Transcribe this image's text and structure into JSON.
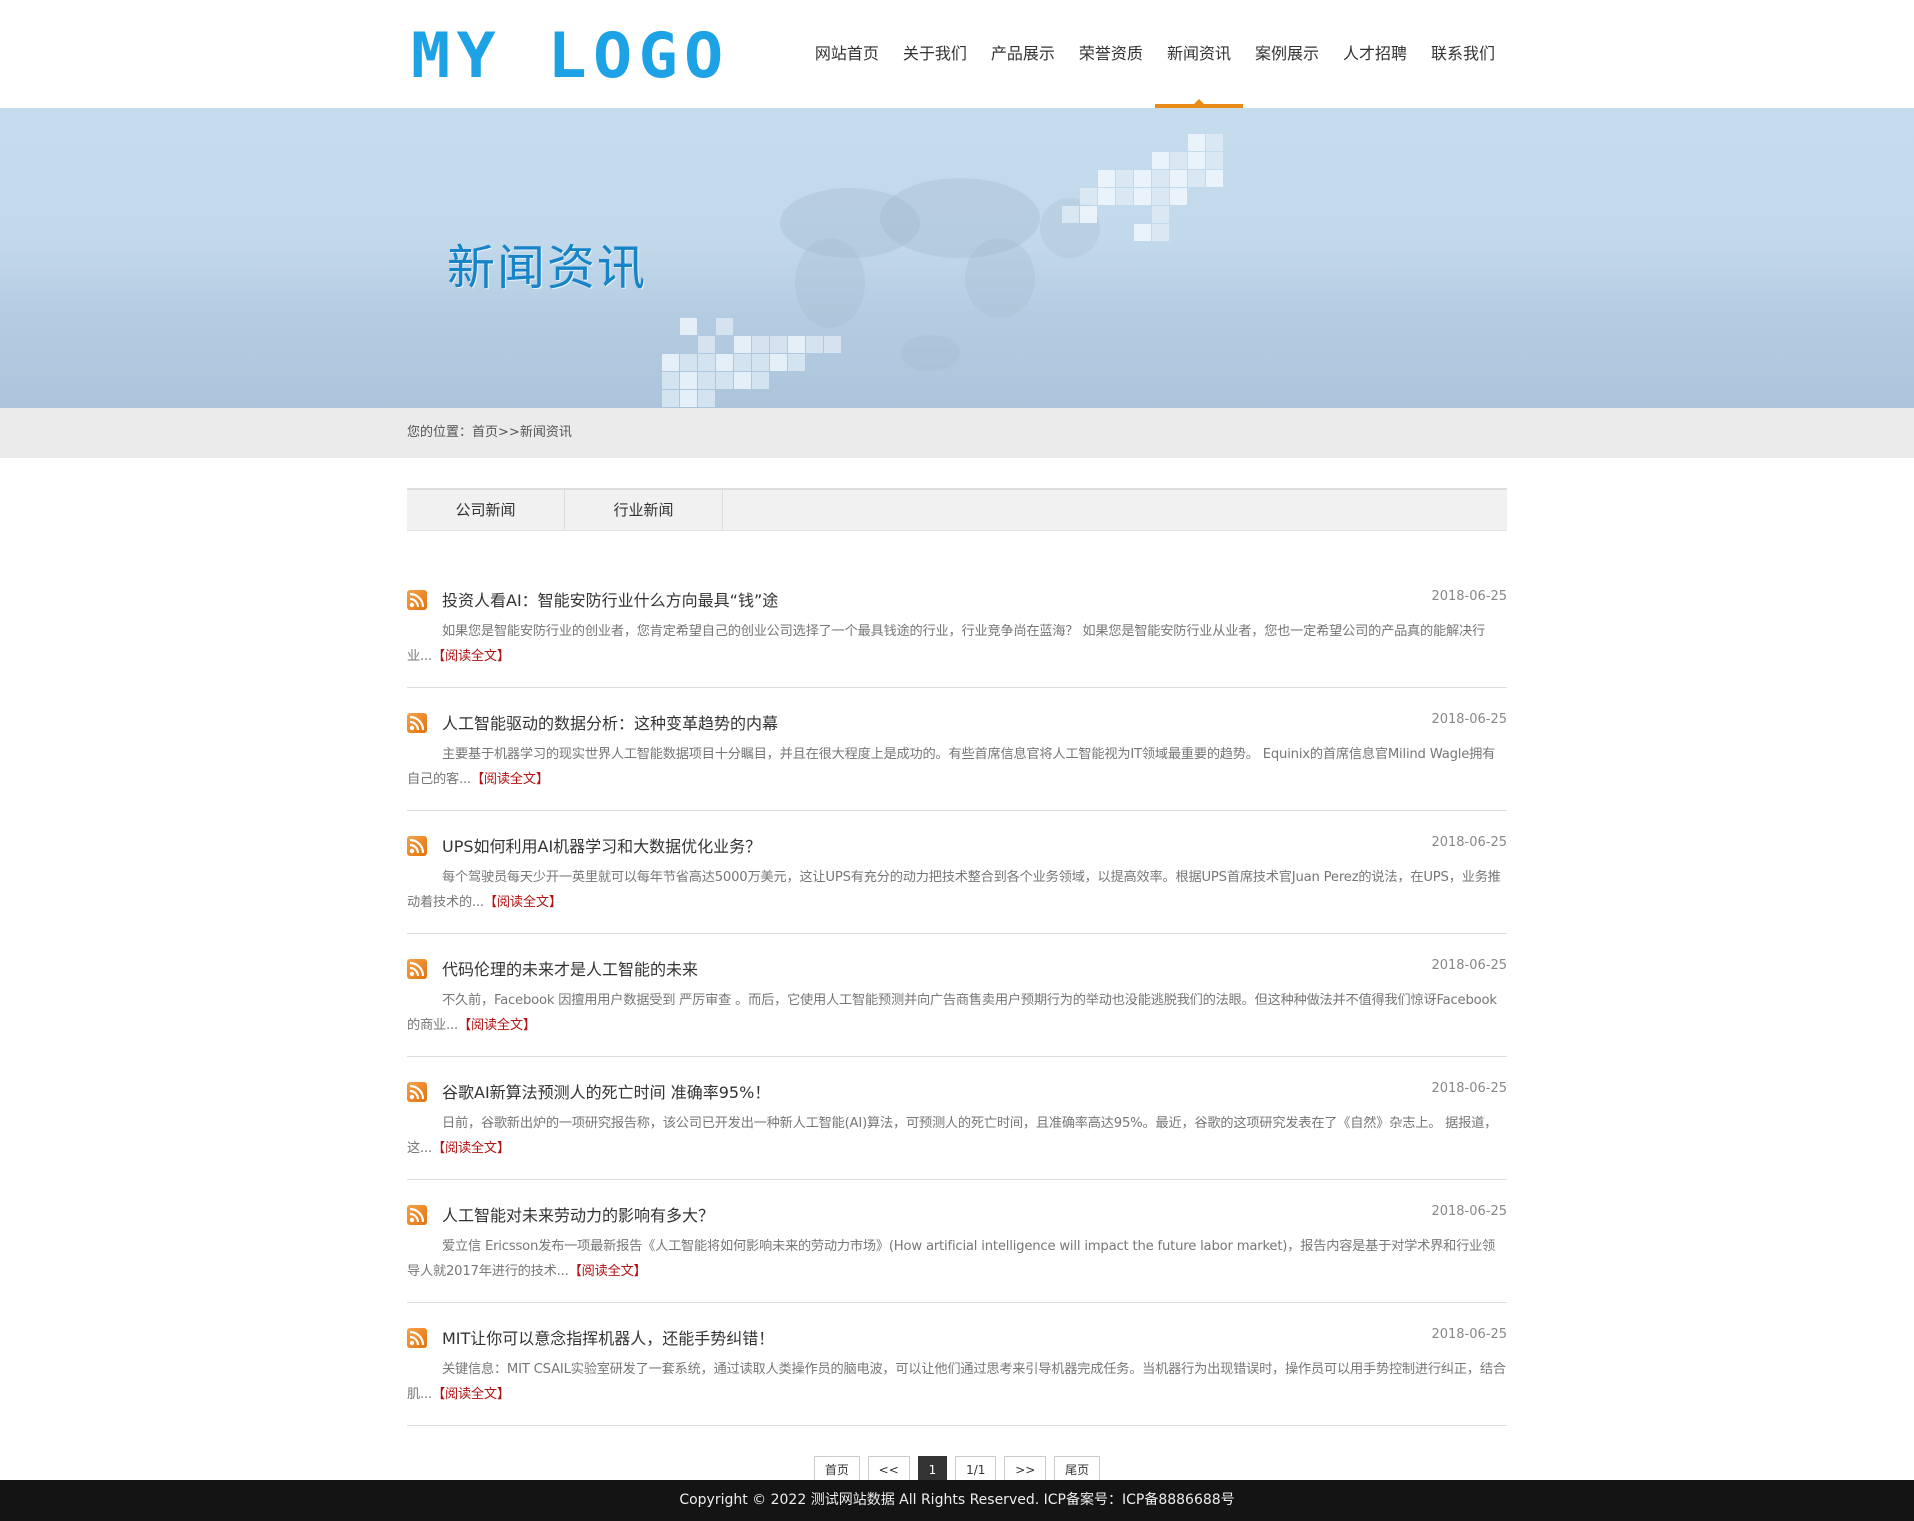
{
  "logo": {
    "text": "MY LOGO"
  },
  "nav": {
    "items": [
      "网站首页",
      "关于我们",
      "产品展示",
      "荣誉资质",
      "新闻资讯",
      "案例展示",
      "人才招聘",
      "联系我们"
    ],
    "active": "新闻资讯"
  },
  "banner": {
    "title": "新闻资讯"
  },
  "breadcrumb": {
    "prefix": "您的位置：",
    "home": "首页",
    "separator": ">>",
    "current": "新闻资讯"
  },
  "tabs": [
    "公司新闻",
    "行业新闻"
  ],
  "news": [
    {
      "title": "投资人看AI：智能安防行业什么方向最具“钱”途",
      "date": "2018-06-25",
      "summary": "如果您是智能安防行业的创业者，您肯定希望自己的创业公司选择了一个最具钱途的行业，行业竞争尚在蓝海？ 如果您是智能安防行业从业者，您也一定希望公司的产品真的能解决行业...",
      "more": "【阅读全文】"
    },
    {
      "title": "人工智能驱动的数据分析：这种变革趋势的内幕",
      "date": "2018-06-25",
      "summary": "主要基于机器学习的现实世界人工智能数据项目十分瞩目，并且在很大程度上是成功的。有些首席信息官将人工智能视为IT领域最重要的趋势。 Equinix的首席信息官Milind Wagle拥有自己的客...",
      "more": "【阅读全文】"
    },
    {
      "title": "UPS如何利用AI机器学习和大数据优化业务？",
      "date": "2018-06-25",
      "summary": "每个驾驶员每天少开一英里就可以每年节省高达5000万美元，这让UPS有充分的动力把技术整合到各个业务领域，以提高效率。根据UPS首席技术官Juan Perez的说法，在UPS，业务推动着技术的...",
      "more": "【阅读全文】"
    },
    {
      "title": "代码伦理的未来才是人工智能的未来",
      "date": "2018-06-25",
      "summary": "不久前，Facebook 因擅用用户数据受到 严厉审查 。而后，它使用人工智能预测并向广告商售卖用户预期行为的举动也没能逃脱我们的法眼。但这种种做法并不值得我们惊讶Facebook 的商业...",
      "more": "【阅读全文】"
    },
    {
      "title": "谷歌AI新算法预测人的死亡时间 准确率95%！",
      "date": "2018-06-25",
      "summary": "日前，谷歌新出炉的一项研究报告称，该公司已开发出一种新人工智能(AI)算法，可预测人的死亡时间，且准确率高达95%。最近，谷歌的这项研究发表在了《自然》杂志上。 据报道，这...",
      "more": "【阅读全文】"
    },
    {
      "title": "人工智能对未来劳动力的影响有多大？",
      "date": "2018-06-25",
      "summary": "爱立信 Ericsson发布一项最新报告《人工智能将如何影响未来的劳动力市场》(How artificial intelligence will impact the future labor market)，报告内容是基于对学术界和行业领导人就2017年进行的技术...",
      "more": "【阅读全文】"
    },
    {
      "title": "MIT让你可以意念指挥机器人，还能手势纠错！",
      "date": "2018-06-25",
      "summary": "关键信息：MIT CSAIL实验室研发了一套系统，通过读取人类操作员的脑电波，可以让他们通过思考来引导机器完成任务。当机器行为出现错误时，操作员可以用手势控制进行纠正，结合肌...",
      "more": "【阅读全文】"
    }
  ],
  "pager": {
    "first": "首页",
    "prev": "<<",
    "current": "1",
    "pages": "1/1",
    "next": ">>",
    "last": "尾页"
  },
  "footer": {
    "text": "Copyright © 2022 测试网站数据 All Rights Reserved.   ICP备案号：ICP备8886688号"
  },
  "colors": {
    "accent": "#e98b16",
    "logo": "#1ea2e6",
    "banner_title": "#1784c8",
    "read_more": "#b01414"
  }
}
